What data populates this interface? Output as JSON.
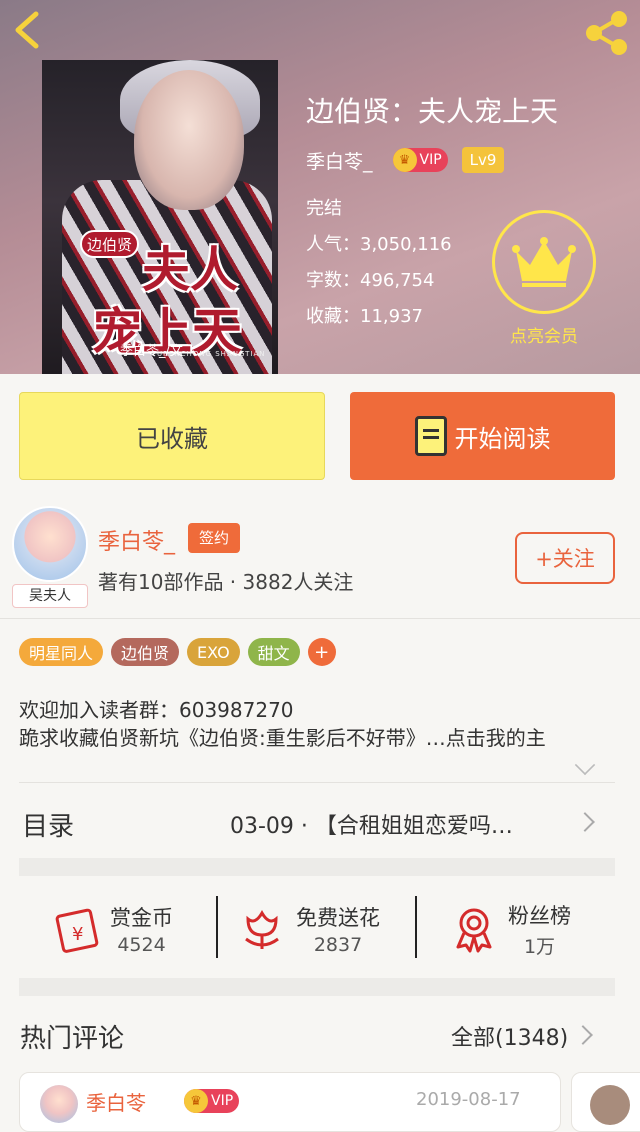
{
  "header": {
    "back_icon": "chevron-left-icon",
    "share_icon": "share-icon",
    "cover": {
      "tag": "边伯贤",
      "big_line1": "夫人",
      "big_line2": "宠上天",
      "pinyin": "FURENCHONG SHANGTIAN",
      "author_tag": "季白苓_/文"
    }
  },
  "book": {
    "title": "边伯贤：夫人宠上天",
    "author": "季白苓_",
    "vip_label": "VIP",
    "level": "Lv9",
    "status": "完结",
    "popularity": "人气：3,050,116",
    "word_count": "字数：496,754",
    "favorites": "收藏：11,937"
  },
  "member": {
    "icon": "crown-icon",
    "label": "点亮会员"
  },
  "actions": {
    "collected_label": "已收藏",
    "read_label": "开始阅读",
    "read_icon": "book-icon"
  },
  "author_card": {
    "avatar_tag": "吴夫人",
    "name": "季白苓_",
    "sign_badge": "签约",
    "meta": "著有10部作品 · 3882人关注",
    "follow_label": "+关注"
  },
  "tags": [
    {
      "label": "明星同人",
      "color": "#f4a93b"
    },
    {
      "label": "边伯贤",
      "color": "#b4695d"
    },
    {
      "label": "EXO",
      "color": "#d9a43a"
    },
    {
      "label": "甜文",
      "color": "#8fb54a"
    },
    {
      "label": "+",
      "color": "#ef6b3a"
    }
  ],
  "intro": {
    "line1": "欢迎加入读者群：603987270",
    "line2": "跪求收藏伯贤新坑《边伯贤:重生影后不好带》…点击我的主"
  },
  "toc": {
    "label": "目录",
    "latest": "03-09 · 【合租姐姐恋爱吗…"
  },
  "support": [
    {
      "icon": "red-envelope-icon",
      "label": "赏金币",
      "count": "4524"
    },
    {
      "icon": "flower-icon",
      "label": "免费送花",
      "count": "2837"
    },
    {
      "icon": "ribbon-medal-icon",
      "label": "粉丝榜",
      "count": "1万"
    }
  ],
  "comments": {
    "label": "热门评论",
    "all_label": "全部(1348)",
    "first": {
      "name": "季白苓",
      "vip": "VIP",
      "date": "2019-08-17"
    }
  },
  "colors": {
    "accent": "#ef6b3a",
    "collect_yellow": "#fdf27a",
    "member_yellow": "#ffe64a"
  }
}
